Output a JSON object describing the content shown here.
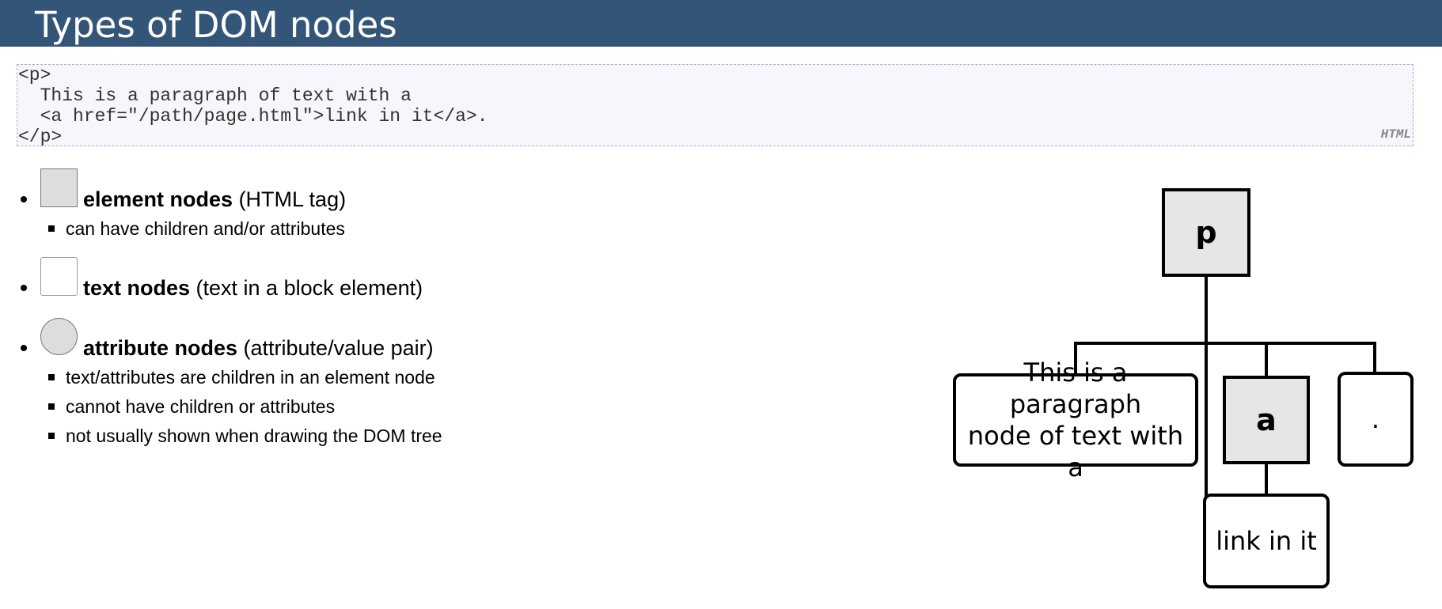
{
  "slide": {
    "title": "Types of DOM nodes"
  },
  "code": {
    "text": "<p>\n  This is a paragraph of text with a\n  <a href=\"/path/page.html\">link in it</a>.\n</p>",
    "language": "HTML"
  },
  "list": {
    "items": [
      {
        "swatch": "element-node-swatch",
        "bold": "element nodes",
        "rest": " (HTML tag)",
        "subitems": [
          "can have children and/or attributes"
        ]
      },
      {
        "swatch": "text-node-swatch",
        "bold": "text nodes",
        "rest": " (text in a block element)",
        "subitems": []
      },
      {
        "swatch": "attribute-node-swatch",
        "bold": "attribute nodes",
        "rest": " (attribute/value pair)",
        "subitems": [
          "text/attributes are children in an element node",
          "cannot have children or attributes",
          "not usually shown when drawing the DOM tree"
        ]
      }
    ]
  },
  "tree": {
    "root": "p",
    "text_node_line1": "This is a paragraph",
    "text_node_line2": "node of text with a",
    "child_element": "a",
    "period_node": ".",
    "link_text_node": "link in it"
  },
  "colors": {
    "title_bar": "#335577",
    "element_fill": "#e6e6e6"
  }
}
